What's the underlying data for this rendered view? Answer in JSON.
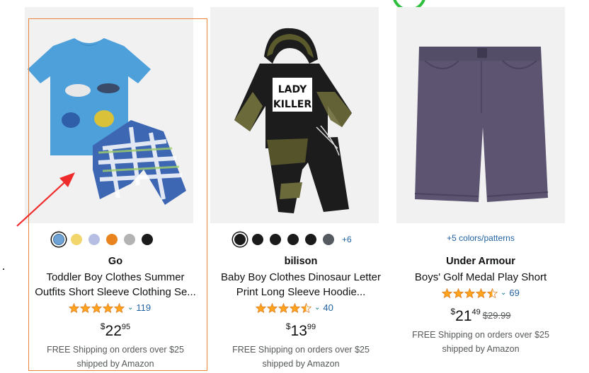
{
  "products": [
    {
      "brand": "Go",
      "title_line1": "Toddler Boy Clothes Summer",
      "title_line2": "Outfits Short Sleeve Clothing Se...",
      "rating_count": "119",
      "price_dollar": "$",
      "price_whole": "22",
      "price_cents": "95",
      "ship_line1": "FREE Shipping on orders over $25",
      "ship_line2": "shipped by Amazon",
      "swatch_colors": [
        "#6fa3d6",
        "#f2d66b",
        "#b6bfe3",
        "#e8831e",
        "#b3b3b3",
        "#1b1b1b"
      ],
      "stars": 5
    },
    {
      "brand": "bilison",
      "title_line1": "Baby Boy Clothes Dinosaur Letter",
      "title_line2": "Print Long Sleeve Hoodie...",
      "rating_count": "40",
      "price_dollar": "$",
      "price_whole": "13",
      "price_cents": "99",
      "ship_line1": "FREE Shipping on orders over $25",
      "ship_line2": "shipped by Amazon",
      "swatch_colors": [
        "#1b1b1b",
        "#1b1b1b",
        "#1b1b1b",
        "#1b1b1b",
        "#1b1b1b",
        "#545a60"
      ],
      "swatch_more": "+6",
      "stars": 4.5,
      "image_text_1": "LADY",
      "image_text_2": "KILLER"
    },
    {
      "brand": "Under Armour",
      "title_line1": "Boys' Golf Medal Play Short",
      "rating_count": "69",
      "price_dollar": "$",
      "price_whole": "21",
      "price_cents": "49",
      "price_was": "$29.99",
      "ship_line1": "FREE Shipping on orders over $25",
      "ship_line2": "shipped by Amazon",
      "colors_link": "+5 colors/patterns",
      "stars": 4.5
    }
  ],
  "colors": {
    "star": "#ffa41c",
    "link": "#2162a1",
    "highlight_border": "#e8833a",
    "arrow": "#ef2b2b"
  }
}
